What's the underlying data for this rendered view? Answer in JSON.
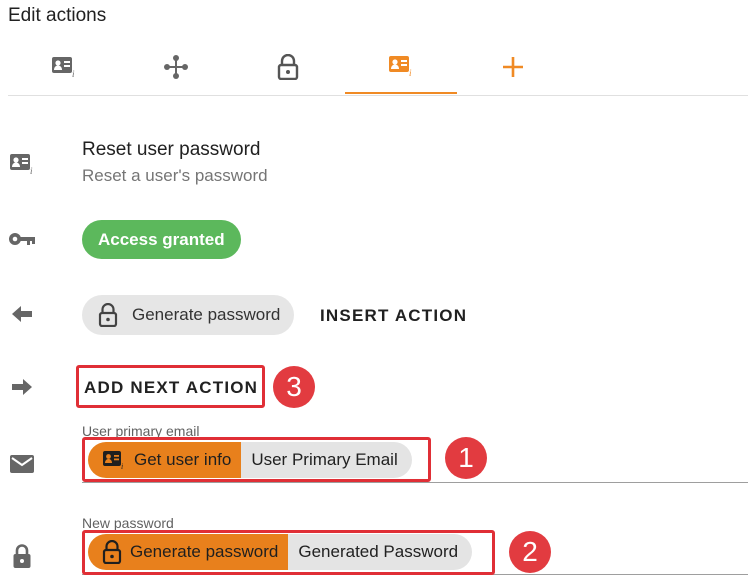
{
  "header": {
    "title": "Edit actions"
  },
  "tabs": [
    {
      "icon": "user-info-icon",
      "active": false
    },
    {
      "icon": "flow-branch-icon",
      "active": false
    },
    {
      "icon": "lock-icon",
      "active": false
    },
    {
      "icon": "user-info-icon",
      "active": true
    },
    {
      "icon": "plus-icon",
      "active": false
    }
  ],
  "action": {
    "title": "Reset user password",
    "description": "Reset a user's password",
    "access_label": "Access granted",
    "previous_action_label": "Generate password",
    "insert_action_label": "INSERT ACTION",
    "add_next_action_label": "ADD NEXT ACTION"
  },
  "fields": {
    "email": {
      "label": "User primary email",
      "source": "Get user info",
      "value": "User Primary Email"
    },
    "password": {
      "label": "New password",
      "source": "Generate password",
      "value": "Generated Password"
    }
  },
  "annotations": [
    "1",
    "2",
    "3"
  ],
  "colors": {
    "accent": "#f08a24",
    "token_orange": "#e8801c",
    "success": "#5cb85c",
    "highlight_red": "#e02f36"
  }
}
